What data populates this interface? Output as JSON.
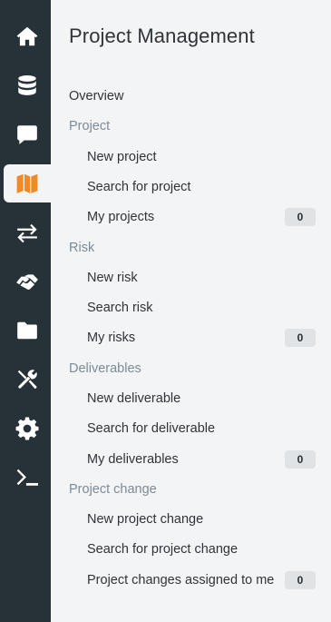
{
  "sidebar": {
    "items": [
      {
        "icon": "home-icon"
      },
      {
        "icon": "database-icon"
      },
      {
        "icon": "chat-icon"
      },
      {
        "icon": "map-icon",
        "active": true
      },
      {
        "icon": "exchange-icon"
      },
      {
        "icon": "handshake-icon"
      },
      {
        "icon": "folder-icon"
      },
      {
        "icon": "tools-icon"
      },
      {
        "icon": "gear-icon"
      },
      {
        "icon": "terminal-icon"
      }
    ],
    "icon_color": "#ffffff",
    "active_icon_color": "#f08a24",
    "background": "#263238"
  },
  "panel": {
    "title": "Project Management",
    "overview": "Overview",
    "sections": [
      {
        "label": "Project",
        "items": [
          {
            "label": "New project"
          },
          {
            "label": "Search for project"
          },
          {
            "label": "My projects",
            "count": "0"
          }
        ]
      },
      {
        "label": "Risk",
        "items": [
          {
            "label": "New risk"
          },
          {
            "label": "Search risk"
          },
          {
            "label": "My risks",
            "count": "0"
          }
        ]
      },
      {
        "label": "Deliverables",
        "items": [
          {
            "label": "New deliverable"
          },
          {
            "label": "Search for deliverable"
          },
          {
            "label": "My deliverables",
            "count": "0"
          }
        ]
      },
      {
        "label": "Project change",
        "items": [
          {
            "label": "New project change"
          },
          {
            "label": "Search for project change"
          },
          {
            "label": "Project changes assigned to me",
            "count": "0"
          }
        ]
      }
    ]
  }
}
